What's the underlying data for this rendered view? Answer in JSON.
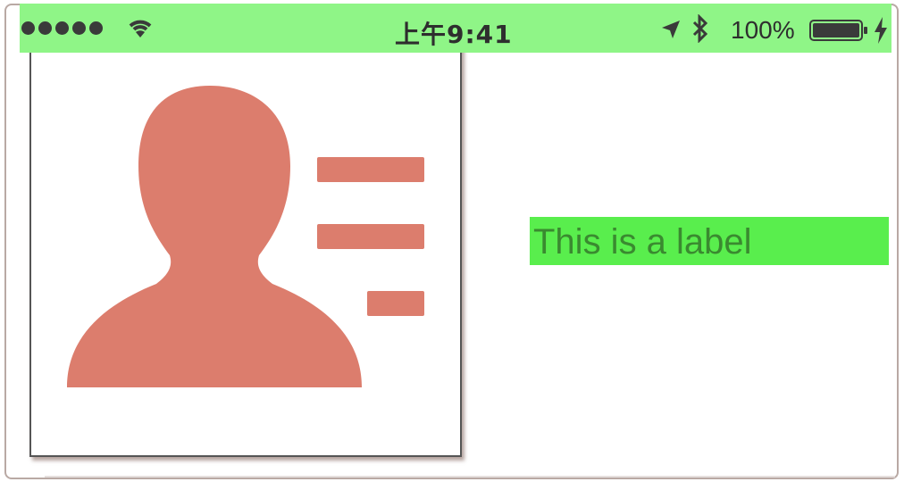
{
  "status_bar": {
    "time": "上午9:41",
    "battery_percent": "100%",
    "signal_bars": 5,
    "battery_level": 1.0
  },
  "content": {
    "label_text": "This is a label"
  },
  "icons": {
    "card_image": "contact-card-icon",
    "wifi": "wifi-icon",
    "location": "location-arrow-icon",
    "bluetooth": "bluetooth-icon",
    "battery": "battery-icon",
    "charging": "charging-bolt-icon"
  },
  "colors": {
    "status_bar_bg": "#8ff587",
    "label_bg": "#59ee4d",
    "icon_color": "#dc7d6d"
  }
}
